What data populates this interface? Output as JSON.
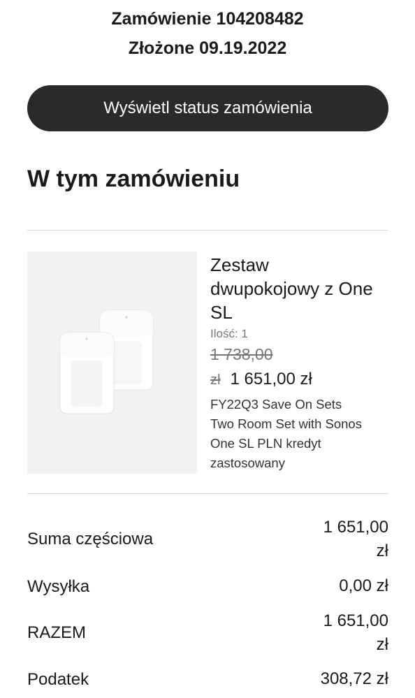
{
  "order": {
    "number_line": "Zamówienie 104208482",
    "placed_line": "Złożone 09.19.2022"
  },
  "status_button_label": "Wyświetl status zamówienia",
  "section_title": "W tym zamówieniu",
  "item": {
    "name_line1": "Zestaw",
    "name_line2": "dwupokojowy z One",
    "name_line3": "SL",
    "quantity": "Ilość: 1",
    "original_price": "1 738,00",
    "currency_strikethrough": "zł",
    "price": "1 651,00 zł",
    "promo_line1": "FY22Q3 Save On Sets",
    "promo_line2": "Two Room Set with Sonos",
    "promo_line3": "One SL PLN kredyt",
    "promo_line4": "zastosowany"
  },
  "summary": {
    "subtotal_label": "Suma częściowa",
    "subtotal_value_line1": "1 651,00",
    "subtotal_value_line2": "zł",
    "shipping_label": "Wysyłka",
    "shipping_value": "0,00 zł",
    "total_label": "RAZEM",
    "total_value_line1": "1 651,00",
    "total_value_line2": "zł",
    "tax_label": "Podatek",
    "tax_value": "308,72 zł"
  },
  "colors": {
    "button_bg": "#2a2a2a",
    "image_bg": "#f2f2f2",
    "divider": "#d9d9d9"
  }
}
